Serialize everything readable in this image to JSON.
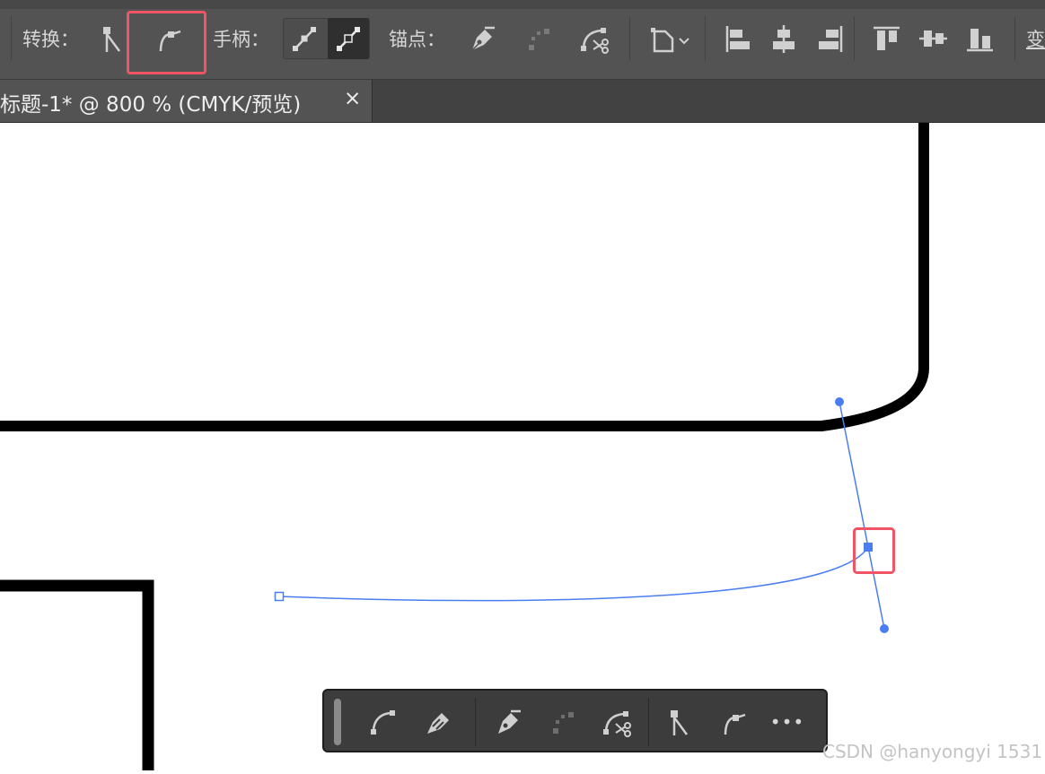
{
  "toolbar": {
    "convert_label": "转换：",
    "handles_label": "手柄：",
    "anchors_label": "锚点：",
    "transform_label_partial": "变",
    "icons": [
      "corner-point-icon",
      "smooth-point-icon",
      "hide-handles-icon",
      "show-handles-icon",
      "remove-anchor-icon",
      "connect-endpoints-icon",
      "cut-path-icon",
      "transform-bounds-icon",
      "align-left-icon",
      "align-h-center-icon",
      "align-right-icon",
      "align-top-icon",
      "align-v-center-icon",
      "align-bottom-icon"
    ]
  },
  "document_tab": {
    "title": "标题-1* @ 800 % (CMYK/预览)",
    "close_glyph": "×"
  },
  "floating_toolbar": {
    "icons": [
      "smooth-curve-icon",
      "eraser-pen-icon",
      "remove-anchor-icon",
      "connect-endpoints-icon",
      "cut-path-icon",
      "corner-point-icon",
      "smooth-point-icon",
      "more-icon"
    ],
    "more_glyph": "•••"
  },
  "watermark": "CSDN @hanyongyi 1531",
  "colors": {
    "toolbar_bg": "#535353",
    "tab_bar_bg": "#424242",
    "highlight": "#ef5565",
    "path_blue": "#4a7ef0",
    "canvas_bg": "#ffffff",
    "stroke_black": "#000000"
  }
}
